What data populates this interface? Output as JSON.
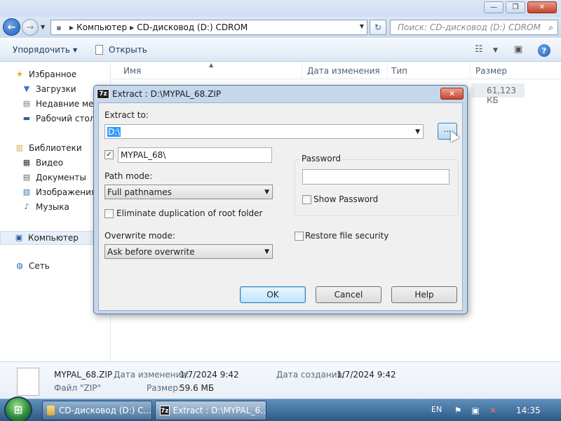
{
  "explorer": {
    "window_buttons": {
      "minimize": "—",
      "maximize": "❐",
      "close": "✕"
    },
    "address": {
      "crumbs": [
        "Компьютер",
        "CD-дисковод (D:) CDROM"
      ]
    },
    "search": {
      "placeholder": "Поиск: CD-дисковод (D:) CDROM"
    },
    "toolbar": {
      "organize_label": "Упорядочить",
      "open_label": "Открыть"
    },
    "nav": {
      "favorites": "Избранное",
      "downloads": "Загрузки",
      "recent": "Недавние мест",
      "desktop": "Рабочий стол",
      "libraries": "Библиотеки",
      "video": "Видео",
      "documents": "Документы",
      "images": "Изображения",
      "music": "Музыка",
      "computer": "Компьютер",
      "network": "Сеть"
    },
    "columns": {
      "name": "Имя",
      "date": "Дата изменения",
      "type": "Тип",
      "size": "Размер"
    },
    "file_row": {
      "size": "61,123 КБ"
    },
    "details": {
      "filename": "MYPAL_68.ZIP",
      "modified_label": "Дата изменения:",
      "modified_value": "1/7/2024 9:42",
      "created_label": "Дата создания:",
      "created_value": "1/7/2024 9:42",
      "file_type": "Файл \"ZIP\"",
      "size_label": "Размер:",
      "size_value": "59.6 МБ"
    }
  },
  "dialog": {
    "title": "Extract : D:\\MYPAL_68.ZIP",
    "extract_to_label": "Extract to:",
    "extract_to_value": "D:\\",
    "browse_label": "...",
    "subfolder_value": "MYPAL_68\\",
    "subfolder_checked": true,
    "path_mode_label": "Path mode:",
    "path_mode_value": "Full pathnames",
    "eliminate_label": "Eliminate duplication of root folder",
    "overwrite_label": "Overwrite mode:",
    "overwrite_value": "Ask before overwrite",
    "password_label": "Password",
    "show_password_label": "Show Password",
    "restore_security_label": "Restore file security",
    "ok_label": "OK",
    "cancel_label": "Cancel",
    "help_label": "Help"
  },
  "taskbar": {
    "task1": "CD-дисковод (D:) C...",
    "task2": "Extract : D:\\MYPAL_6...",
    "lang": "EN",
    "clock": "14:35"
  },
  "icons": {
    "favorites": "star-icon",
    "computer": "computer-icon",
    "network": "network-icon"
  },
  "colors": {
    "selection": "#3399ff",
    "taskbar": "#2c5a86",
    "close_button": "#c7432c"
  }
}
